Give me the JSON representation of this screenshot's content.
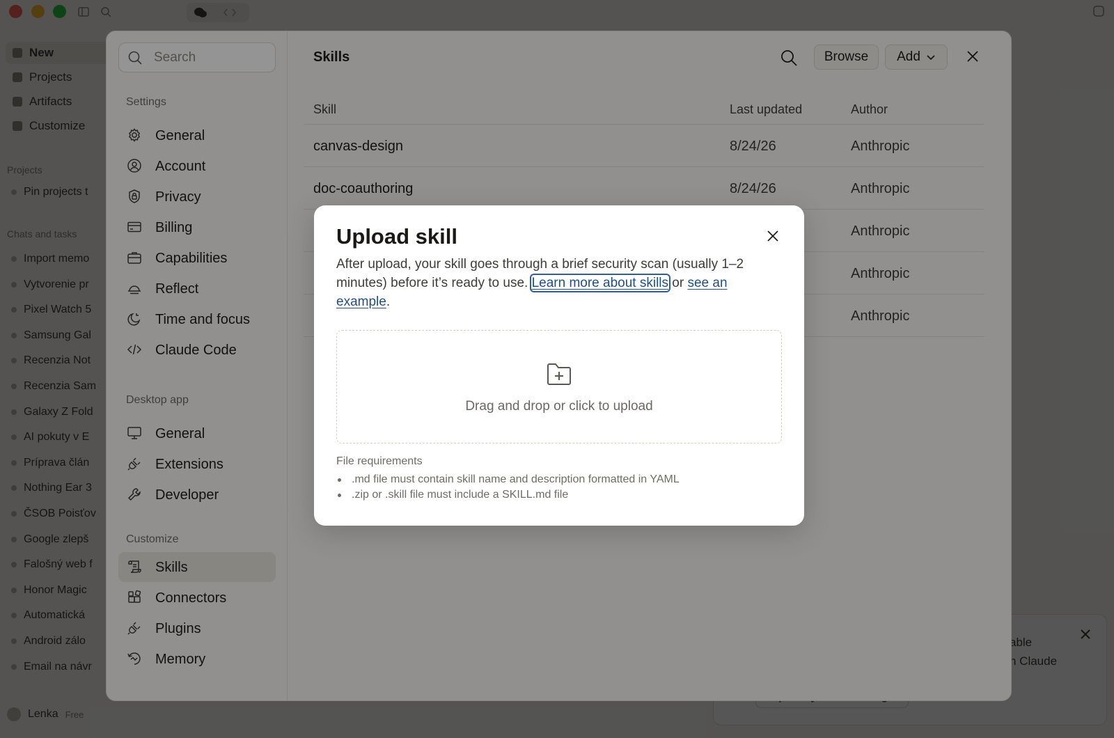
{
  "background": {
    "nav_items": [
      "New",
      "Projects",
      "Artifacts",
      "Customize"
    ],
    "projects_heading": "Projects",
    "projects_pin_hint": "Pin projects t",
    "chats_heading": "Chats and tasks",
    "chats": [
      "Import memo",
      "Vytvorenie pr",
      "Pixel Watch 5",
      "Samsung Gal",
      "Recenzia Not",
      "Recenzia Sam",
      "Galaxy Z Fold",
      "AI pokuty v E",
      "Príprava člán",
      "Nothing Ear 3",
      "ČSOB Poisťov",
      "Google zlepš",
      "Falošný web f",
      "Honor Magic",
      "Automatická",
      "Android zálo",
      "Email na návr"
    ],
    "user_name": "Lenka",
    "user_plan": "Free",
    "toast_text_line1": "able",
    "toast_text_line2": "n Claude",
    "toast_button": "Open System Settings"
  },
  "settings": {
    "search_placeholder": "Search",
    "sections": {
      "settings": "Settings",
      "desktop_app": "Desktop app",
      "customize": "Customize"
    },
    "items": {
      "general": "General",
      "account": "Account",
      "privacy": "Privacy",
      "billing": "Billing",
      "capabilities": "Capabilities",
      "reflect": "Reflect",
      "time_and_focus": "Time and focus",
      "claude_code": "Claude Code",
      "desktop_general": "General",
      "extensions": "Extensions",
      "developer": "Developer",
      "skills": "Skills",
      "connectors": "Connectors",
      "plugins": "Plugins",
      "memory": "Memory"
    },
    "active_item": "skills"
  },
  "skills": {
    "title": "Skills",
    "browse_label": "Browse",
    "add_label": "Add",
    "columns": {
      "skill": "Skill",
      "last_updated": "Last updated",
      "author": "Author"
    },
    "rows": [
      {
        "name": "canvas-design",
        "updated": "8/24/26",
        "author": "Anthropic"
      },
      {
        "name": "doc-coauthoring",
        "updated": "8/24/26",
        "author": "Anthropic"
      },
      {
        "name": "",
        "updated": "",
        "author": "Anthropic"
      },
      {
        "name": "",
        "updated": "",
        "author": "Anthropic"
      },
      {
        "name": "",
        "updated": "",
        "author": "Anthropic"
      }
    ]
  },
  "modal": {
    "title": "Upload skill",
    "desc_prefix": "After upload, your skill goes through a brief security scan (usually 1–2 minutes) before it’s ready to use. ",
    "learn_more_link": "Learn more about skills",
    "desc_or": " or ",
    "example_link": "see an example",
    "desc_suffix": ".",
    "dropzone_text": "Drag and drop or click to upload",
    "requirements_title": "File requirements",
    "requirements": [
      ".md file must contain skill name and description formatted in YAML",
      ".zip or .skill file must include a SKILL.md file"
    ]
  }
}
